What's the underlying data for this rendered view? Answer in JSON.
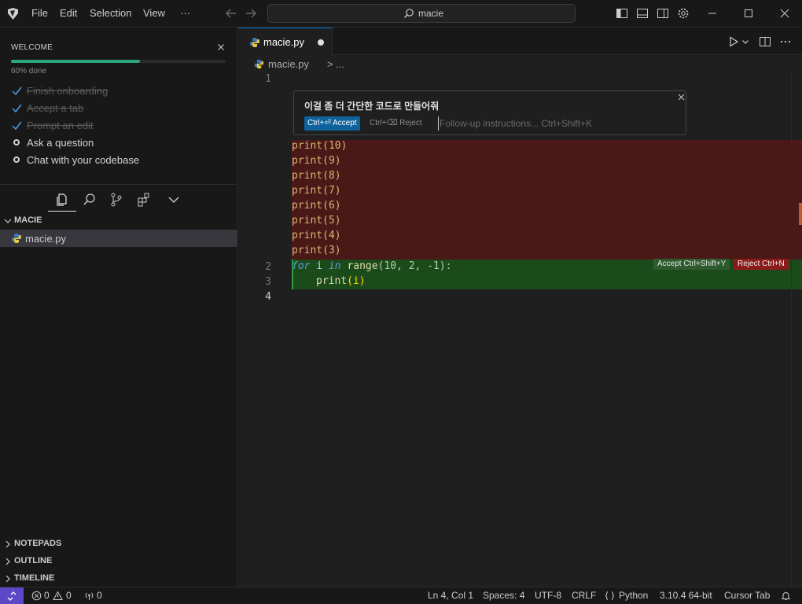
{
  "menu": {
    "file": "File",
    "edit": "Edit",
    "selection": "Selection",
    "view": "View",
    "more": "···"
  },
  "search": {
    "text": "macie"
  },
  "welcome": {
    "title": "WELCOME",
    "progress_percent": 60,
    "progress_text": "60% done",
    "steps": [
      {
        "label": "Finish onboarding",
        "done": true
      },
      {
        "label": "Accept a tab",
        "done": true
      },
      {
        "label": "Prompt an edit",
        "done": true
      },
      {
        "label": "Ask a question",
        "done": false
      },
      {
        "label": "Chat with your codebase",
        "done": false
      }
    ]
  },
  "explorer": {
    "folder": "MACIE",
    "file": "macie.py",
    "sections": {
      "notepads": "NOTEPADS",
      "outline": "OUTLINE",
      "timeline": "TIMELINE"
    }
  },
  "editor": {
    "tab": "macie.py",
    "breadcrumb": {
      "file": "macie.py",
      "sep": ">",
      "more": "..."
    },
    "line_numbers": {
      "l1": "1",
      "l2": "2",
      "l3": "3",
      "l4": "4"
    },
    "prompt": {
      "text": "이걸 좀 더 간단한 코드로 만들어줘",
      "accept": "Ctrl+⏎ Accept",
      "reject": "Ctrl+⌫ Reject",
      "placeholder": "Follow-up instructions... Ctrl+Shift+K"
    },
    "removed_lines": [
      "print(10)",
      "print(9)",
      "print(8)",
      "print(7)",
      "print(6)",
      "print(5)",
      "print(4)",
      "print(3)"
    ],
    "added": {
      "l2_kw1": "for",
      "l2_var": " i ",
      "l2_kw2": "in",
      "l2_fn": " range",
      "l2_args": "(10, 2, -1):",
      "l3_fn": "print",
      "l3_args": "(i)"
    },
    "chips": {
      "accept": "Accept Ctrl+Shift+Y",
      "reject": "Reject Ctrl+N"
    }
  },
  "status": {
    "errors": "0",
    "warnings": "0",
    "ports": "0",
    "position": "Ln 4, Col 1",
    "spaces": "Spaces: 4",
    "encoding": "UTF-8",
    "eol": "CRLF",
    "language": "Python",
    "interpreter": "3.10.4 64-bit",
    "cursor_tab": "Cursor Tab"
  },
  "colors": {
    "accent": "#0078d4",
    "removed_bg": "#4b1818",
    "added_bg": "#1b4b1b",
    "progress": "#2aa87a"
  }
}
